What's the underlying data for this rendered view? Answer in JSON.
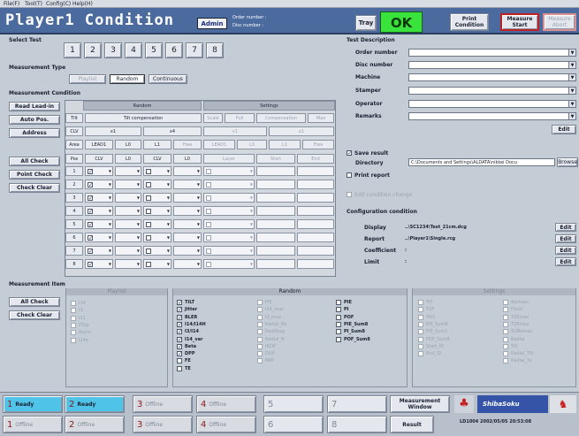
{
  "menu": [
    "File(F)",
    "Tool(T)",
    "Config(C)",
    "Help(H)"
  ],
  "header": {
    "title": "Player1 Condition",
    "admin": "Admin",
    "order_label": "Order number :",
    "disc_label": "Disc number :",
    "tray": "Tray",
    "ok": "OK",
    "print_cond": "Print Condition",
    "measure_start": "Measure Start",
    "measure_abort": "Measure Abort"
  },
  "select_test": {
    "label": "Select Test",
    "buttons": [
      "1",
      "2",
      "3",
      "4",
      "5",
      "6",
      "7",
      "8"
    ]
  },
  "mtype": {
    "label": "Measurement Type",
    "buttons": [
      "Playlist",
      "Random",
      "Continuous"
    ]
  },
  "mcond": {
    "label": "Measurement Condition",
    "left_buttons": [
      "Read Lead-in",
      "Auto Pos.",
      "Address",
      "All Check",
      "Point Check",
      "Check Clear"
    ],
    "random": "Random",
    "settings": "Settings",
    "tilt": "Tilt",
    "tilt_val": "Tilt compensation",
    "scale": "Scale",
    "scale_val": "Full",
    "comp": "Compensation",
    "comp_val": "Max",
    "clv": "CLV",
    "clv1": "x1",
    "clv2": "x4",
    "clv3": "x1",
    "clv4": "x1",
    "area": "Area",
    "area_cols": [
      "LEAD1",
      "L0",
      "L1",
      "Free",
      "LEAD1",
      "L0",
      "L1",
      "Free"
    ],
    "pos": "Pos",
    "cols": [
      "CLV",
      "L0",
      "CLV",
      "L0",
      "Layer",
      "Start",
      "End"
    ],
    "rows": [
      "1",
      "2",
      "3",
      "4",
      "5",
      "6",
      "7",
      "8"
    ]
  },
  "test_desc": {
    "label": "Test Description",
    "fields": [
      "Order number",
      "Disc number",
      "Machine",
      "Stamper",
      "Operator",
      "Remarks"
    ],
    "edit": "Edit"
  },
  "save": {
    "save_result": "Save result",
    "dir_label": "Directory",
    "dir_val": "C:\\Documents and Settings\\ALDATA\\nikkei Docu",
    "browse": "Browse",
    "print_report": "Print report",
    "edit_cond": "Edit condition change"
  },
  "config": {
    "label": "Configuration condition",
    "rows": [
      {
        "k": "Display",
        "v": "..\\SC1234\\Test_21cm.dcg"
      },
      {
        "k": "Report",
        "v": "..\\Player1\\Single.rcg"
      },
      {
        "k": "Coefficient",
        "v": ""
      },
      {
        "k": "Limit",
        "v": ""
      }
    ],
    "edit": "Edit"
  },
  "item": {
    "label": "Measurement Item",
    "buttons": [
      "All Check",
      "Check Clear"
    ],
    "g1": {
      "title": "Playlist",
      "items": [
        "I14",
        "I3",
        "I11",
        "ITOp",
        "Asym",
        "I14p"
      ]
    },
    "g2": {
      "title": "Random",
      "col1": [
        "TILT",
        "Jitter",
        "BLER",
        "I14/I14H",
        "I3/I14",
        "I14_var",
        "Beta",
        "DPP",
        "FE",
        "TE"
      ],
      "col2": [
        "PIE",
        "I14_max",
        "I3_max",
        "Radial_Ns",
        "RadSkag",
        "Radial_N",
        "IRDP",
        "DGP",
        "NPP"
      ],
      "col3": [
        "PIE",
        "PI",
        "POF",
        "PIE_Sum8",
        "PI_Sum8",
        "POF_Sum8"
      ]
    },
    "g3": {
      "title": "Settings",
      "col1": [
        "TIP",
        "T1P",
        "TAD",
        "PIE_Sum8",
        "PIE_Sum1",
        "POF_Sum8",
        "Start_ID",
        "End_ID"
      ],
      "col2": [
        "Address",
        "FlaxV",
        "T1Emax",
        "T1Pmax",
        "SUBemax",
        "Radial",
        "Tilt",
        "Radial_Tilt",
        "Radial_Tx"
      ]
    }
  },
  "taskbar": {
    "buttons": [
      "Ready",
      "Ready",
      "Offline",
      "Offline",
      "Offline",
      "Offline",
      "Offline",
      "Offline"
    ],
    "meas_window": "Measurement Window",
    "result": "Result",
    "brand": "ShibaSoku",
    "clock": "LD1004 2002/05/05 20:53:08"
  }
}
